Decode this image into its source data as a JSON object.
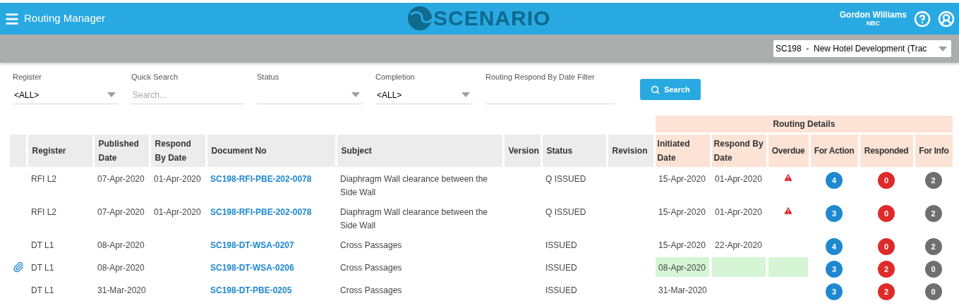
{
  "header": {
    "title": "Routing Manager",
    "logo_text": "SCENARIO",
    "user_name": "Gordon Williams",
    "user_org": "NBC"
  },
  "project_select": {
    "value": "SC198  -  New Hotel Development (Trac"
  },
  "filters": [
    {
      "kind": "select",
      "label": "Register",
      "value": "<ALL>"
    },
    {
      "kind": "input",
      "label": "Quick Search",
      "placeholder": "Search..."
    },
    {
      "kind": "select",
      "label": "Status"
    },
    {
      "kind": "select",
      "label": "Completion",
      "value": "<ALL>"
    },
    {
      "kind": "input",
      "label": "Routing Respond By Date Filter"
    }
  ],
  "search_button": "Search",
  "table": {
    "group_header": "Routing Details",
    "columns": [
      "Register",
      "Published Date",
      "Respond By Date",
      "Document No",
      "Subject",
      "Version",
      "Status",
      "Revision",
      "Initiated Date",
      "Respond By Date",
      "Overdue",
      "For Action",
      "Responded",
      "For Info"
    ],
    "rows": [
      {
        "attachment": false,
        "highlighted": false,
        "overdue": true,
        "register": "RFI L2",
        "published": "07-Apr-2020",
        "respond_by": "01-Apr-2020",
        "document_no": "SC198-RFI-PBE-202-0078",
        "subject": "Diaphragm Wall clearance between the Side Wall",
        "status": "Q ISSUED",
        "initiated": "15-Apr-2020",
        "routing_respond_by": "01-Apr-2020",
        "for_action": "4",
        "responded": "0",
        "for_info": "2"
      },
      {
        "attachment": false,
        "highlighted": false,
        "overdue": true,
        "register": "RFI L2",
        "published": "07-Apr-2020",
        "respond_by": "01-Apr-2020",
        "document_no": "SC198-RFI-PBE-202-0078",
        "subject": "Diaphragm Wall clearance between the Side Wall",
        "status": "Q ISSUED",
        "initiated": "15-Apr-2020",
        "routing_respond_by": "01-Apr-2020",
        "for_action": "3",
        "responded": "0",
        "for_info": "2"
      },
      {
        "attachment": false,
        "highlighted": false,
        "overdue": false,
        "register": "DT L1",
        "published": "08-Apr-2020",
        "document_no": "SC198-DT-WSA-0207",
        "subject": "Cross Passages",
        "status": "ISSUED",
        "initiated": "15-Apr-2020",
        "routing_respond_by": "22-Apr-2020",
        "for_action": "4",
        "responded": "0",
        "for_info": "2"
      },
      {
        "attachment": true,
        "highlighted": true,
        "overdue": false,
        "register": "DT L1",
        "published": "08-Apr-2020",
        "document_no": "SC198-DT-WSA-0206",
        "subject": "Cross Passages",
        "status": "ISSUED",
        "initiated": "08-Apr-2020",
        "for_action": "3",
        "responded": "2",
        "for_info": "0"
      },
      {
        "attachment": false,
        "highlighted": false,
        "overdue": false,
        "register": "DT L1",
        "published": "31-Mar-2020",
        "document_no": "SC198-DT-PBE-0205",
        "subject": "Cross Passages",
        "status": "ISSUED",
        "initiated": "31-Mar-2020",
        "for_action": "3",
        "responded": "2",
        "for_info": "0"
      }
    ]
  }
}
